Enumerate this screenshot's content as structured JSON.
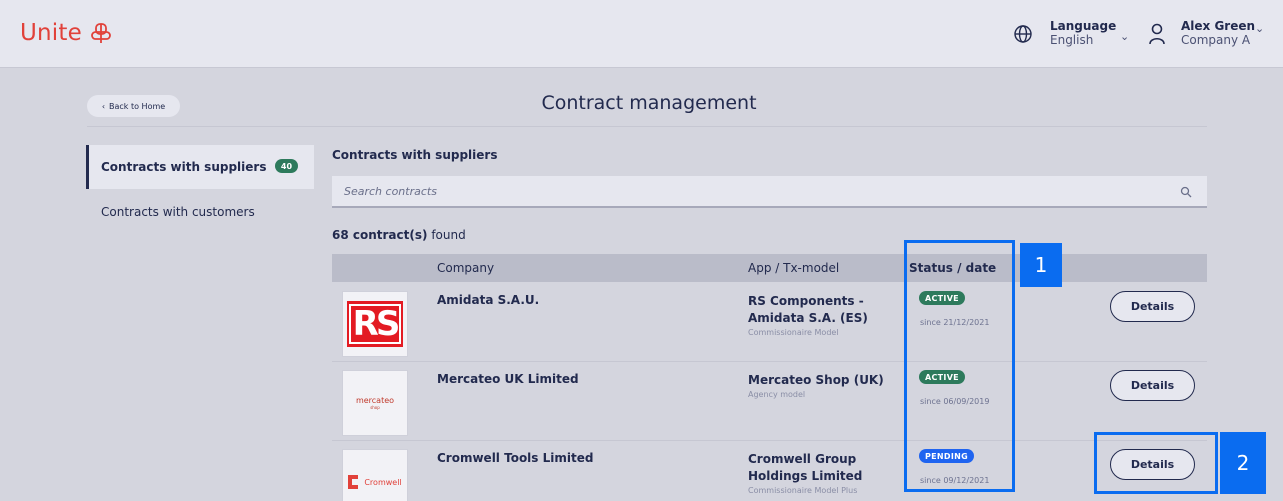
{
  "header": {
    "logo_text": "Unite",
    "language_label": "Language",
    "language_value": "English",
    "user_name": "Alex Green",
    "user_company": "Company A"
  },
  "page": {
    "back_label": "Back to Home",
    "title": "Contract management"
  },
  "sidebar": {
    "items": [
      {
        "label": "Contracts with suppliers",
        "count": "40",
        "active": true
      },
      {
        "label": "Contracts with customers",
        "active": false
      }
    ]
  },
  "main": {
    "section_title": "Contracts with suppliers",
    "search_placeholder": "Search contracts",
    "found_count": "68 contract(s)",
    "found_suffix": " found",
    "columns": [
      "Company",
      "App / Tx-model",
      "Status / date"
    ],
    "details_label": "Details",
    "rows": [
      {
        "logo": "RS",
        "company": "Amidata S.A.U.",
        "app": "RS Components - Amidata S.A. (ES)",
        "model": "Commissionaire Model",
        "status": "ACTIVE",
        "since": "since 21/12/2021"
      },
      {
        "logo": "mercateo",
        "logo_sub": "shop",
        "company": "Mercateo UK Limited",
        "app": "Mercateo Shop (UK)",
        "model": "Agency model",
        "status": "ACTIVE",
        "since": "since 06/09/2019"
      },
      {
        "logo": "Cromwell",
        "company": "Cromwell Tools Limited",
        "app": "Cromwell Group Holdings Limited",
        "model": "Commissionaire Model Plus",
        "status": "PENDING",
        "since": "since 09/12/2021"
      }
    ]
  },
  "annotations": [
    "1",
    "2"
  ],
  "colors": {
    "brand": "#e1413a",
    "active": "#2d7a5c",
    "pending": "#1f64f0",
    "annotation": "#0a6cf0",
    "navy": "#222a4e"
  }
}
